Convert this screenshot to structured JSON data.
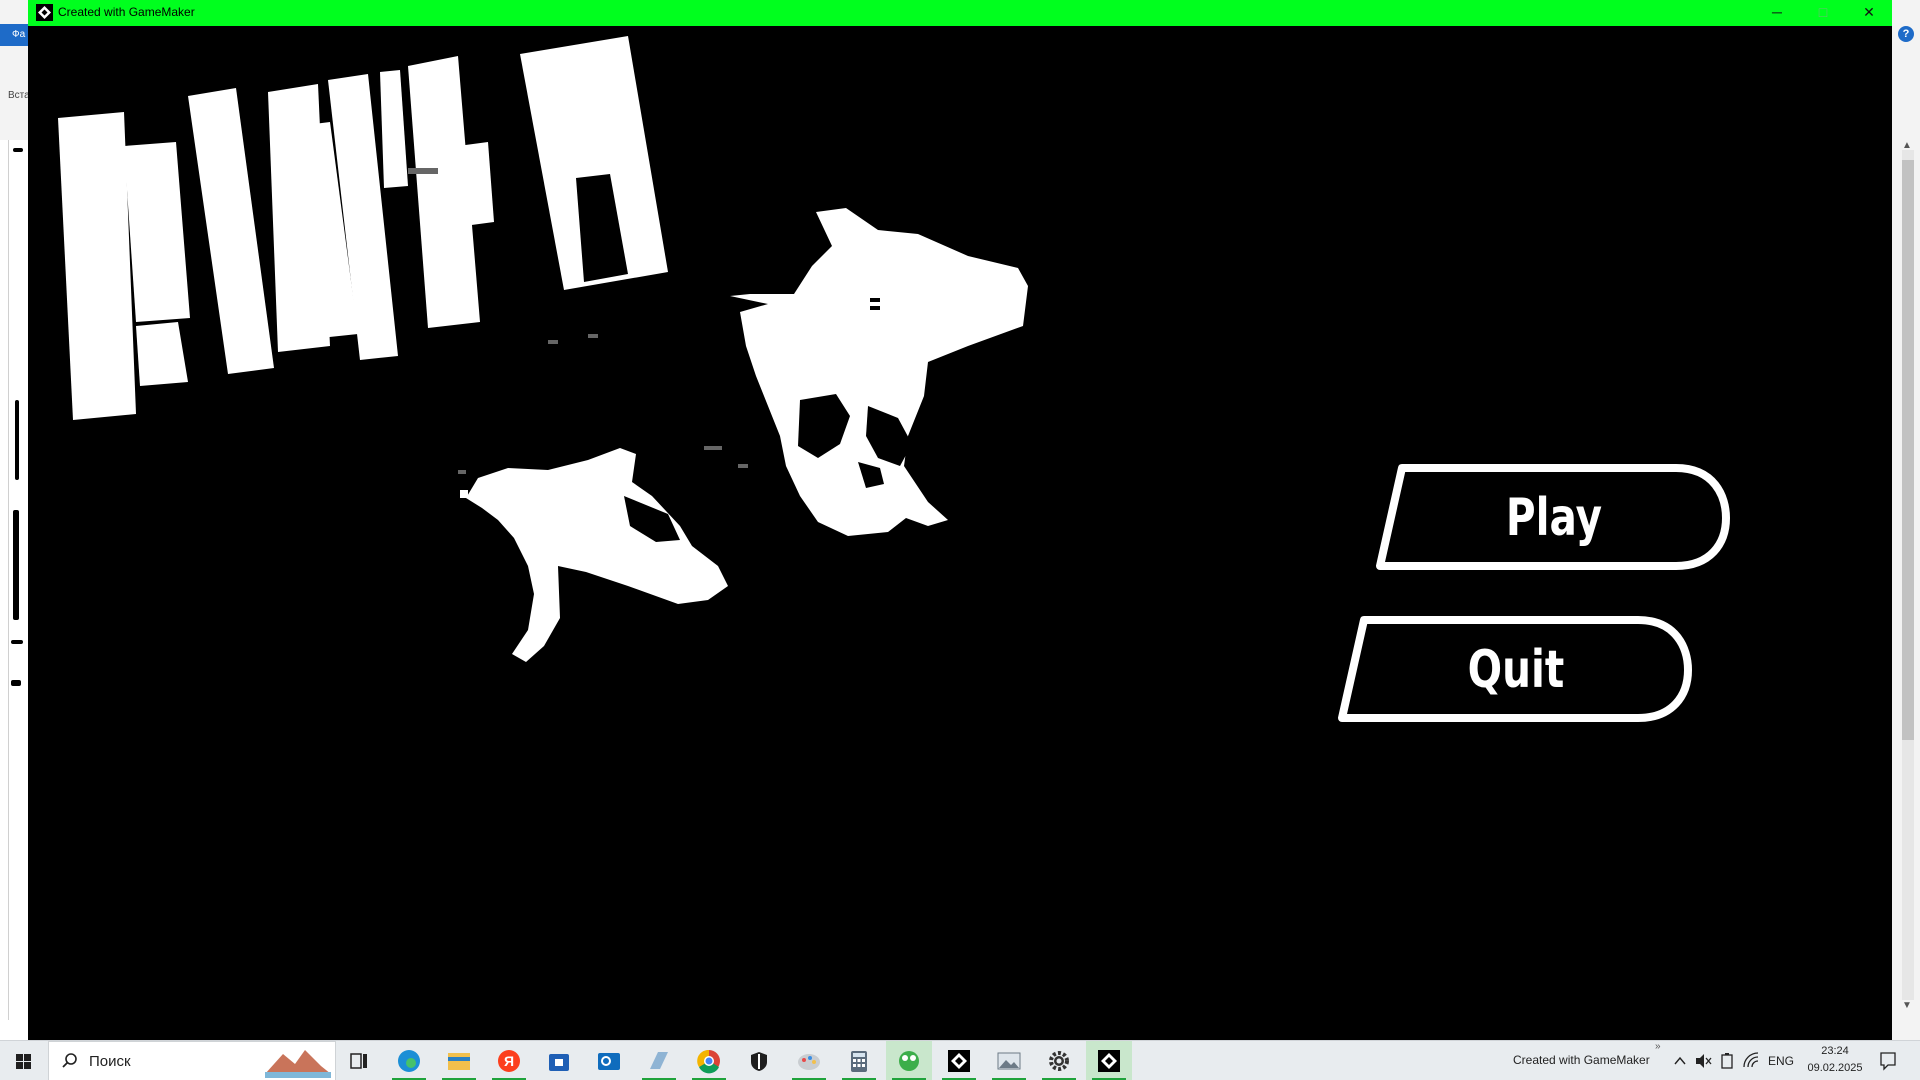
{
  "window": {
    "title": "Created with GameMaker",
    "titlebar_color": "#00ff1e",
    "controls": {
      "minimize": "─",
      "maximize": "□",
      "close": "✕"
    }
  },
  "background_app": {
    "tab_label": "Фа",
    "ribbon_label": "Вста",
    "help_label": "?",
    "accent_color": "#1e6bc8"
  },
  "game": {
    "background_color": "#000000",
    "menu": {
      "play_label": "Play",
      "quit_label": "Quit"
    }
  },
  "taskbar": {
    "search_placeholder": "Поиск",
    "apps": [
      {
        "name": "task-view",
        "icon": "task-view-icon"
      },
      {
        "name": "edge",
        "icon": "edge-icon"
      },
      {
        "name": "file-explorer",
        "icon": "folder-icon"
      },
      {
        "name": "yandex",
        "icon": "yandex-icon"
      },
      {
        "name": "store",
        "icon": "store-icon"
      },
      {
        "name": "outlook",
        "icon": "outlook-icon"
      },
      {
        "name": "notes",
        "icon": "notes-icon"
      },
      {
        "name": "chrome",
        "icon": "chrome-icon"
      },
      {
        "name": "security",
        "icon": "shield-icon"
      },
      {
        "name": "paint",
        "icon": "paint-icon"
      },
      {
        "name": "calculator",
        "icon": "calculator-icon"
      },
      {
        "name": "game-app",
        "icon": "frog-icon"
      },
      {
        "name": "gamemaker",
        "icon": "gamemaker-icon"
      },
      {
        "name": "photos",
        "icon": "photos-icon"
      },
      {
        "name": "settings",
        "icon": "gear-icon"
      },
      {
        "name": "gamemaker-runner",
        "icon": "gamemaker-icon"
      }
    ],
    "tray": {
      "chevron": "»",
      "running_label": "Created with GameMaker",
      "language": "ENG",
      "time": "23:24",
      "date": "09.02.2025"
    }
  }
}
